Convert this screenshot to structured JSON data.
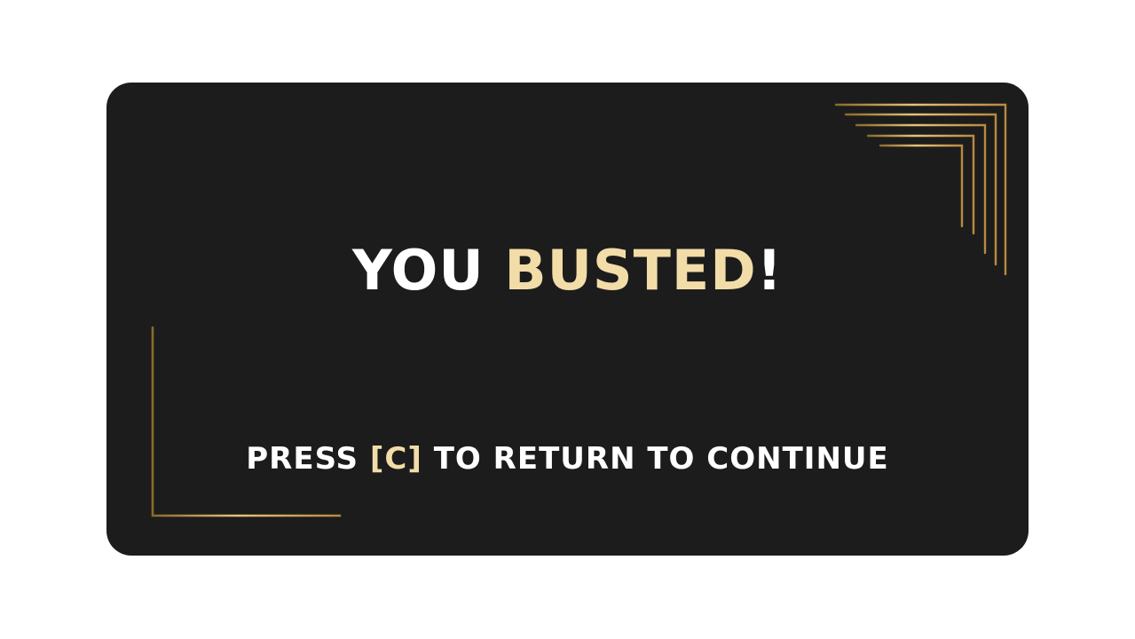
{
  "dialog": {
    "title_part1": "YOU ",
    "title_part2": "BUSTED",
    "title_part3": "!",
    "instruction_part1": "PRESS ",
    "instruction_key": "[C]",
    "instruction_part2": " TO RETURN TO CONTINUE"
  },
  "colors": {
    "card_background": "#1c1c1c",
    "page_background": "#ffffff",
    "text_primary": "#ffffff",
    "text_accent": "#f2dca8",
    "ornament_gold": "#c9a14e"
  },
  "icons": {
    "top_right": "gold-corner-lines-icon",
    "bottom_left": "gold-corner-lines-icon"
  }
}
